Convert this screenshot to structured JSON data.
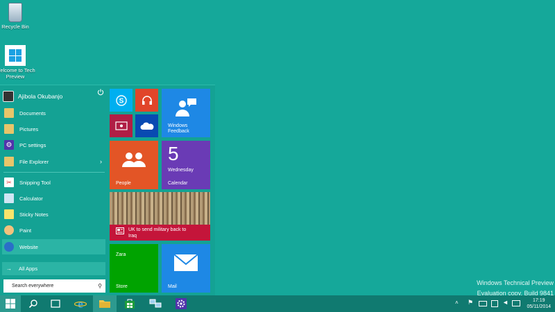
{
  "desktop": {
    "recycle_bin": "Recycle Bin",
    "welcome": "Welcome to Tech Preview",
    "background_color": "#15a89a"
  },
  "start_menu": {
    "user_name": "Ajibola Okubanjo",
    "power_icon": "power-icon",
    "items": [
      {
        "label": "Documents",
        "icon": "folder-icon",
        "color": "#e8c56a"
      },
      {
        "label": "Pictures",
        "icon": "pictures-folder-icon",
        "color": "#e8c56a"
      },
      {
        "label": "PC settings",
        "icon": "gear-icon",
        "color": "#5133ab"
      },
      {
        "label": "File Explorer",
        "icon": "file-explorer-icon",
        "color": "#e8c56a"
      },
      {
        "label": "Snipping Tool",
        "icon": "scissors-icon",
        "color": "#ffffff"
      },
      {
        "label": "Calculator",
        "icon": "calculator-icon",
        "color": "#cfe6f4"
      },
      {
        "label": "Sticky Notes",
        "icon": "sticky-note-icon",
        "color": "#f7e46b"
      },
      {
        "label": "Paint",
        "icon": "paint-palette-icon",
        "color": "#f1c27d"
      },
      {
        "label": "Website",
        "icon": "website-icon",
        "color": "#2a6fc8"
      }
    ],
    "all_apps": "All Apps",
    "search_placeholder": "Search everywhere"
  },
  "tiles": {
    "skype": {
      "color": "#00aff0"
    },
    "music": {
      "color": "#e1452a"
    },
    "video": {
      "color": "#b01e45"
    },
    "onedrive": {
      "color": "#094ab2"
    },
    "feedback": {
      "label": "Windows Feedback",
      "color": "#1e88e5"
    },
    "people": {
      "label": "People",
      "color": "#e35526"
    },
    "calendar": {
      "date": "5",
      "day": "Wednesday",
      "label": "Calendar",
      "color": "#6a3bb5"
    },
    "news": {
      "headline": "UK to send military back to Iraq",
      "color": "#c4153a"
    },
    "store": {
      "sub": "Zara",
      "label": "Store",
      "color": "#00a300"
    },
    "mail": {
      "label": "Mail",
      "color": "#1e88e5"
    }
  },
  "taskbar": {
    "time": "17:19",
    "date": "05/11/2014"
  },
  "watermark": {
    "line1": "Windows Technical Preview",
    "line2": "Evaluation copy. Build 9841"
  }
}
